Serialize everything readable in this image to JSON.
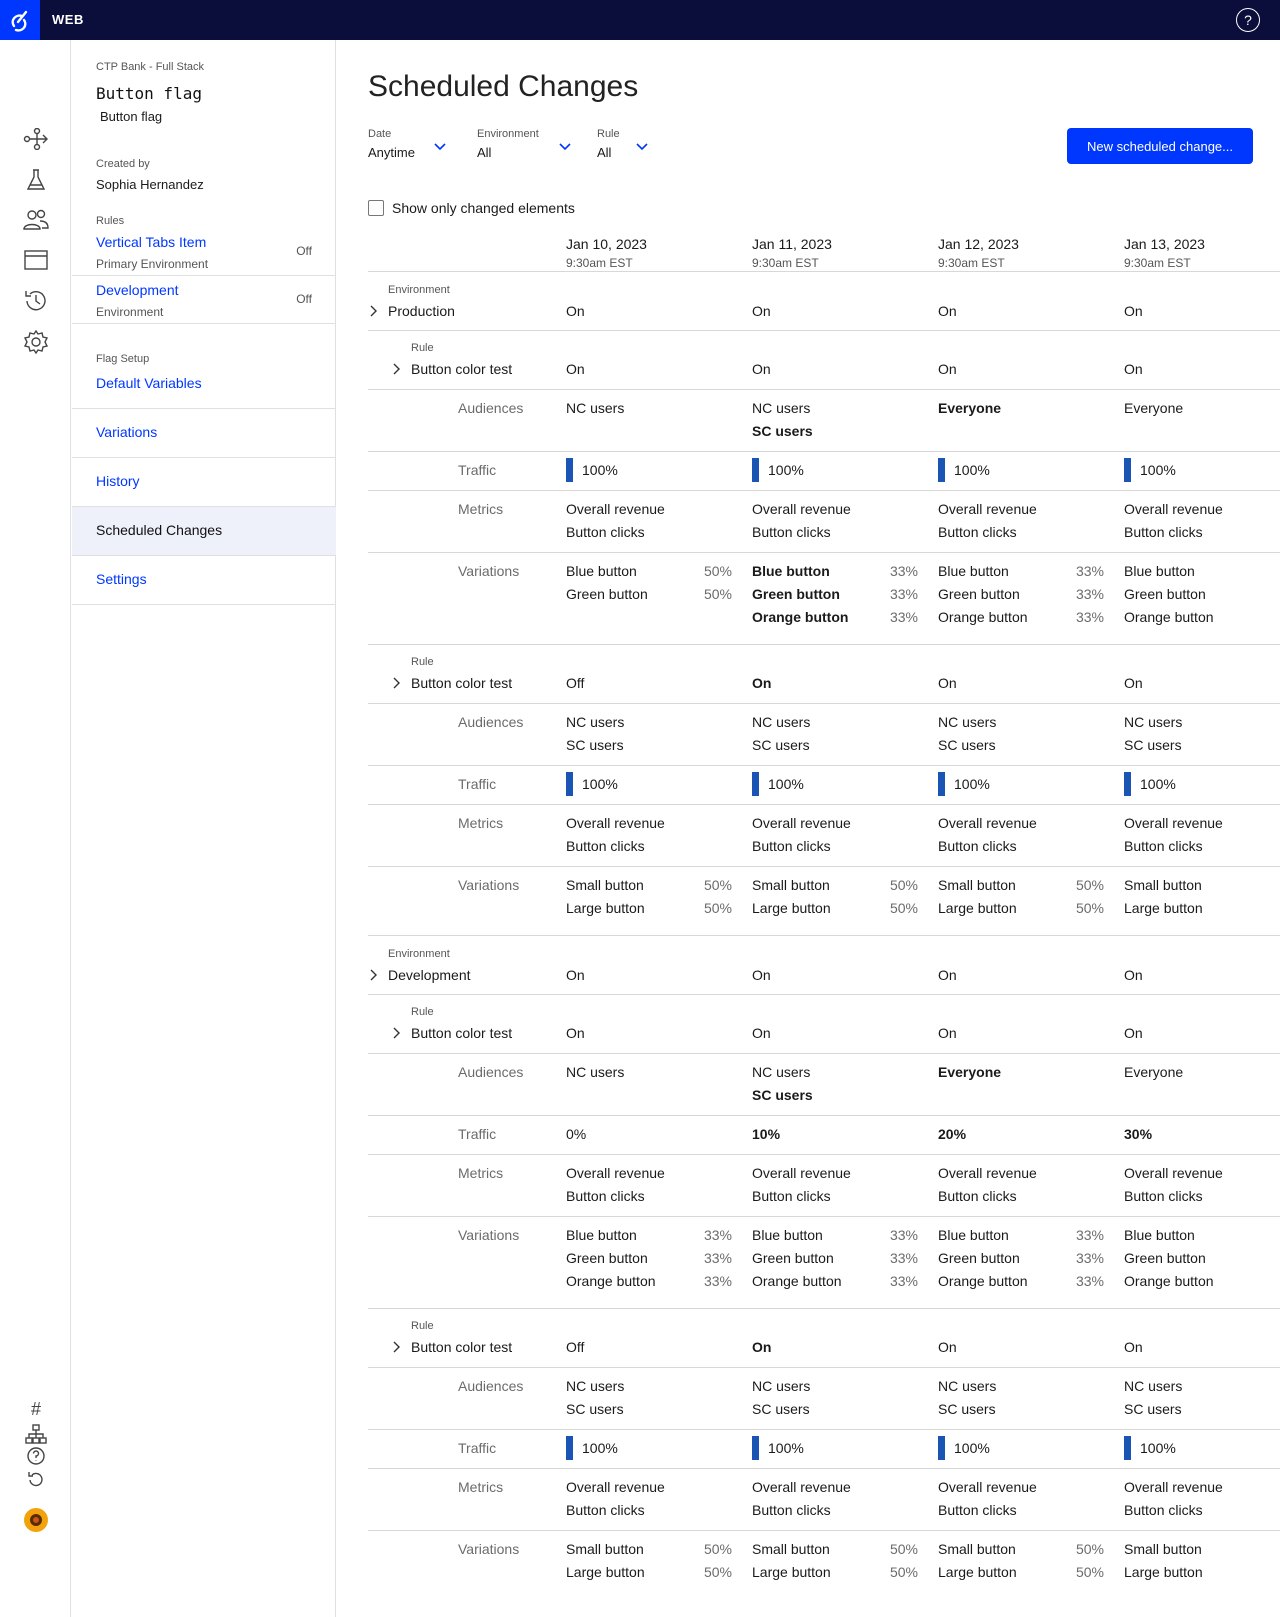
{
  "app": {
    "name": "WEB",
    "help": "?"
  },
  "sidebar": {
    "project": "CTP Bank - Full Stack",
    "flag_key": "Button flag",
    "flag_name": "Button flag",
    "created_by_label": "Created by",
    "created_by": "Sophia Hernandez",
    "rules_label": "Rules",
    "rules": [
      {
        "name": "Vertical Tabs Item",
        "env": "Primary Environment",
        "status": "Off"
      },
      {
        "name": "Development",
        "env": "Environment",
        "status": "Off"
      }
    ],
    "flag_setup_label": "Flag Setup",
    "nav": [
      "Default Variables",
      "Variations",
      "History",
      "Scheduled Changes",
      "Settings"
    ],
    "active_nav": "Scheduled Changes"
  },
  "main": {
    "title": "Scheduled Changes",
    "filters": [
      {
        "label": "Date",
        "value": "Anytime"
      },
      {
        "label": "Environment",
        "value": "All"
      },
      {
        "label": "Rule",
        "value": "All"
      }
    ],
    "new_button": "New scheduled change...",
    "show_only": "Show only changed elements",
    "dates": [
      {
        "date": "Jan 10, 2023",
        "time": "9:30am EST"
      },
      {
        "date": "Jan 11, 2023",
        "time": "9:30am EST"
      },
      {
        "date": "Jan 12, 2023",
        "time": "9:30am EST"
      },
      {
        "date": "Jan 13, 2023",
        "time": "9:30am EST"
      }
    ],
    "labels": {
      "environment": "Environment",
      "rule": "Rule",
      "audiences": "Audiences",
      "traffic": "Traffic",
      "metrics": "Metrics",
      "variations": "Variations"
    },
    "environments": [
      {
        "name": "Production",
        "values": [
          {
            "t": "On"
          },
          {
            "t": "On"
          },
          {
            "t": "On"
          },
          {
            "t": "On"
          }
        ],
        "rules": [
          {
            "name": "Button color test",
            "status": [
              {
                "t": "On"
              },
              {
                "t": "On"
              },
              {
                "t": "On"
              },
              {
                "t": "On"
              }
            ],
            "audiences": [
              [
                {
                  "t": "NC users"
                }
              ],
              [
                {
                  "t": "NC users"
                },
                {
                  "t": "SC users",
                  "b": true
                }
              ],
              [
                {
                  "t": "Everyone",
                  "b": true
                }
              ],
              [
                {
                  "t": "Everyone"
                }
              ]
            ],
            "traffic": [
              {
                "t": "100%",
                "bar": true
              },
              {
                "t": "100%",
                "bar": true
              },
              {
                "t": "100%",
                "bar": true
              },
              {
                "t": "100%",
                "bar": true
              }
            ],
            "metrics": [
              [
                "Overall revenue",
                "Button clicks"
              ],
              [
                "Overall revenue",
                "Button clicks"
              ],
              [
                "Overall revenue",
                "Button clicks"
              ],
              [
                "Overall revenue",
                "Button clicks"
              ]
            ],
            "variations": [
              [
                {
                  "n": "Blue button",
                  "p": "50%"
                },
                {
                  "n": "Green button",
                  "p": "50%"
                }
              ],
              [
                {
                  "n": "Blue button",
                  "p": "33%",
                  "b": true
                },
                {
                  "n": "Green button",
                  "p": "33%",
                  "b": true
                },
                {
                  "n": "Orange button",
                  "p": "33%",
                  "b": true
                }
              ],
              [
                {
                  "n": "Blue button",
                  "p": "33%"
                },
                {
                  "n": "Green button",
                  "p": "33%"
                },
                {
                  "n": "Orange button",
                  "p": "33%"
                }
              ],
              [
                {
                  "n": "Blue button",
                  "p": ""
                },
                {
                  "n": "Green button",
                  "p": ""
                },
                {
                  "n": "Orange button",
                  "p": ""
                }
              ]
            ]
          },
          {
            "name": "Button color test",
            "status": [
              {
                "t": "Off"
              },
              {
                "t": "On",
                "b": true
              },
              {
                "t": "On"
              },
              {
                "t": "On"
              }
            ],
            "audiences": [
              [
                {
                  "t": "NC users"
                },
                {
                  "t": "SC users"
                }
              ],
              [
                {
                  "t": "NC users"
                },
                {
                  "t": "SC users"
                }
              ],
              [
                {
                  "t": "NC users"
                },
                {
                  "t": "SC users"
                }
              ],
              [
                {
                  "t": "NC users"
                },
                {
                  "t": "SC users"
                }
              ]
            ],
            "traffic": [
              {
                "t": "100%",
                "bar": true
              },
              {
                "t": "100%",
                "bar": true
              },
              {
                "t": "100%",
                "bar": true
              },
              {
                "t": "100%",
                "bar": true
              }
            ],
            "metrics": [
              [
                "Overall revenue",
                "Button clicks"
              ],
              [
                "Overall revenue",
                "Button clicks"
              ],
              [
                "Overall revenue",
                "Button clicks"
              ],
              [
                "Overall revenue",
                "Button clicks"
              ]
            ],
            "variations": [
              [
                {
                  "n": "Small button",
                  "p": "50%"
                },
                {
                  "n": "Large button",
                  "p": "50%"
                }
              ],
              [
                {
                  "n": "Small button",
                  "p": "50%"
                },
                {
                  "n": "Large button",
                  "p": "50%"
                }
              ],
              [
                {
                  "n": "Small button",
                  "p": "50%"
                },
                {
                  "n": "Large button",
                  "p": "50%"
                }
              ],
              [
                {
                  "n": "Small button",
                  "p": ""
                },
                {
                  "n": "Large button",
                  "p": ""
                }
              ]
            ]
          }
        ]
      },
      {
        "name": "Development",
        "values": [
          {
            "t": "On"
          },
          {
            "t": "On"
          },
          {
            "t": "On"
          },
          {
            "t": "On"
          }
        ],
        "rules": [
          {
            "name": "Button color test",
            "status": [
              {
                "t": "On"
              },
              {
                "t": "On"
              },
              {
                "t": "On"
              },
              {
                "t": "On"
              }
            ],
            "audiences": [
              [
                {
                  "t": "NC users"
                }
              ],
              [
                {
                  "t": "NC users"
                },
                {
                  "t": "SC users",
                  "b": true
                }
              ],
              [
                {
                  "t": "Everyone",
                  "b": true
                }
              ],
              [
                {
                  "t": "Everyone"
                }
              ]
            ],
            "traffic": [
              {
                "t": "0%"
              },
              {
                "t": "10%",
                "b": true
              },
              {
                "t": "20%",
                "b": true
              },
              {
                "t": "30%",
                "b": true
              }
            ],
            "metrics": [
              [
                "Overall revenue",
                "Button clicks"
              ],
              [
                "Overall revenue",
                "Button clicks"
              ],
              [
                "Overall revenue",
                "Button clicks"
              ],
              [
                "Overall revenue",
                "Button clicks"
              ]
            ],
            "variations": [
              [
                {
                  "n": "Blue button",
                  "p": "33%"
                },
                {
                  "n": "Green button",
                  "p": "33%"
                },
                {
                  "n": "Orange button",
                  "p": "33%"
                }
              ],
              [
                {
                  "n": "Blue button",
                  "p": "33%"
                },
                {
                  "n": "Green button",
                  "p": "33%"
                },
                {
                  "n": "Orange button",
                  "p": "33%"
                }
              ],
              [
                {
                  "n": "Blue button",
                  "p": "33%"
                },
                {
                  "n": "Green button",
                  "p": "33%"
                },
                {
                  "n": "Orange button",
                  "p": "33%"
                }
              ],
              [
                {
                  "n": "Blue button",
                  "p": ""
                },
                {
                  "n": "Green button",
                  "p": ""
                },
                {
                  "n": "Orange button",
                  "p": ""
                }
              ]
            ]
          },
          {
            "name": "Button color test",
            "status": [
              {
                "t": "Off"
              },
              {
                "t": "On",
                "b": true
              },
              {
                "t": "On"
              },
              {
                "t": "On"
              }
            ],
            "audiences": [
              [
                {
                  "t": "NC users"
                },
                {
                  "t": "SC users"
                }
              ],
              [
                {
                  "t": "NC users"
                },
                {
                  "t": "SC users"
                }
              ],
              [
                {
                  "t": "NC users"
                },
                {
                  "t": "SC users"
                }
              ],
              [
                {
                  "t": "NC users"
                },
                {
                  "t": "SC users"
                }
              ]
            ],
            "traffic": [
              {
                "t": "100%",
                "bar": true
              },
              {
                "t": "100%",
                "bar": true
              },
              {
                "t": "100%",
                "bar": true
              },
              {
                "t": "100%",
                "bar": true
              }
            ],
            "metrics": [
              [
                "Overall revenue",
                "Button clicks"
              ],
              [
                "Overall revenue",
                "Button clicks"
              ],
              [
                "Overall revenue",
                "Button clicks"
              ],
              [
                "Overall revenue",
                "Button clicks"
              ]
            ],
            "variations": [
              [
                {
                  "n": "Small button",
                  "p": "50%"
                },
                {
                  "n": "Large button",
                  "p": "50%"
                }
              ],
              [
                {
                  "n": "Small button",
                  "p": "50%"
                },
                {
                  "n": "Large button",
                  "p": "50%"
                }
              ],
              [
                {
                  "n": "Small button",
                  "p": "50%"
                },
                {
                  "n": "Large button",
                  "p": "50%"
                }
              ],
              [
                {
                  "n": "Small button",
                  "p": ""
                },
                {
                  "n": "Large button",
                  "p": ""
                }
              ]
            ]
          }
        ]
      }
    ]
  },
  "colors": {
    "accent": "#0037ff",
    "topbar": "#0b0d3a",
    "bar": "#1a55b3",
    "active_nav_bg": "#eef0fa"
  }
}
